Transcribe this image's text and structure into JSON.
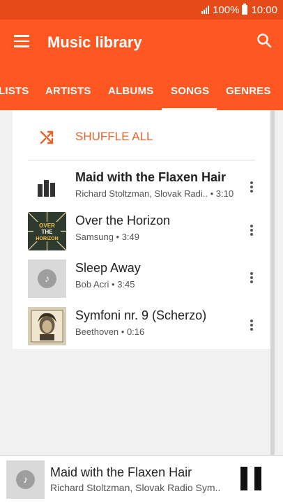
{
  "status_bar": {
    "battery": "100%",
    "time": "10:00"
  },
  "app_bar": {
    "title": "Music library"
  },
  "tabs": [
    "LISTS",
    "ARTISTS",
    "ALBUMS",
    "SONGS",
    "GENRES"
  ],
  "active_tab": "SONGS",
  "shuffle": {
    "label": "SHUFFLE ALL"
  },
  "songs": [
    {
      "title": "Maid with the Flaxen Hair",
      "subtitle": "Richard Stoltzman, Slovak Radi..  • 3:10",
      "playing": true
    },
    {
      "title": "Over the Horizon",
      "subtitle": "Samsung • 3:49",
      "art_text": [
        "OVER",
        "THE",
        "HORIZON"
      ]
    },
    {
      "title": "Sleep Away",
      "subtitle": "Bob Acri • 3:45"
    },
    {
      "title": "Symfoni nr. 9 (Scherzo)",
      "subtitle": "Beethoven • 0:16"
    }
  ],
  "now_playing": {
    "title": "Maid with the Flaxen Hair",
    "subtitle": "Richard Stoltzman, Slovak Radio Sym.."
  },
  "colors": {
    "accent": "#ff5722",
    "status": "#e64a19",
    "shuffle_text": "#e8622b"
  },
  "icons": {
    "menu": "menu-icon",
    "search": "search-icon",
    "shuffle": "shuffle-icon",
    "pause": "pause-icon"
  }
}
